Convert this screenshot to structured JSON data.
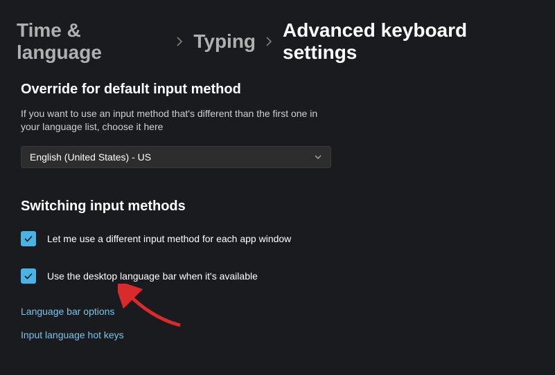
{
  "breadcrumb": {
    "level1": "Time & language",
    "level2": "Typing",
    "current": "Advanced keyboard settings"
  },
  "section1": {
    "title": "Override for default input method",
    "description": "If you want to use an input method that's different than the first one in your language list, choose it here",
    "dropdown_value": "English (United States) - US"
  },
  "section2": {
    "title": "Switching input methods",
    "checkbox1_label": "Let me use a different input method for each app window",
    "checkbox1_checked": true,
    "checkbox2_label": "Use the desktop language bar when it's available",
    "checkbox2_checked": true,
    "link1": "Language bar options",
    "link2": "Input language hot keys"
  }
}
